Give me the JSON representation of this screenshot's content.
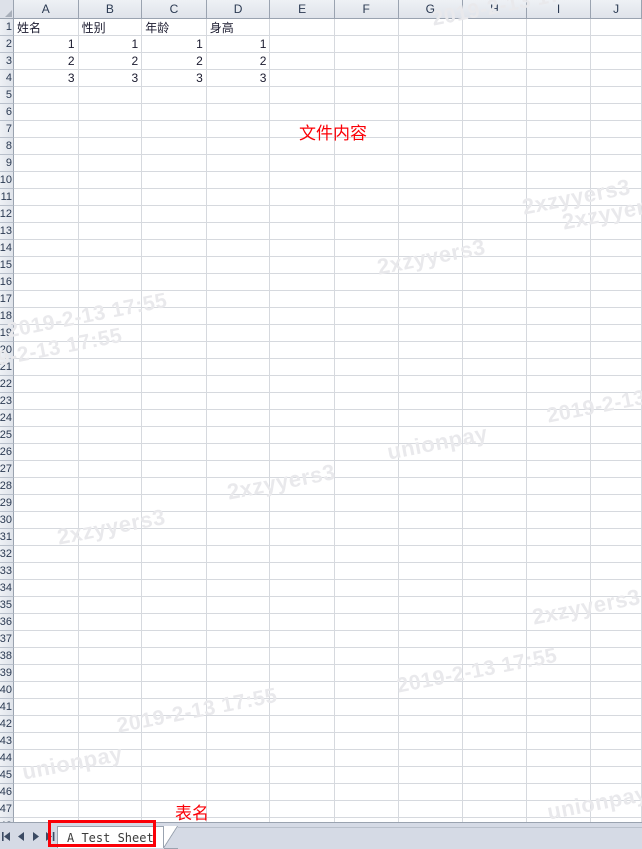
{
  "app": {
    "type": "spreadsheet",
    "sheet_tab_label": "A Test Sheet"
  },
  "grid": {
    "column_headers": [
      "A",
      "B",
      "C",
      "D",
      "E",
      "F",
      "G",
      "H",
      "I",
      "J"
    ],
    "row_count": 48,
    "first_row_number": 1,
    "cells": {
      "row1": [
        "姓名",
        "性别",
        "年龄",
        "身高"
      ],
      "row2": [
        "1",
        "1",
        "1",
        "1"
      ],
      "row3": [
        "2",
        "2",
        "2",
        "2"
      ],
      "row4": [
        "3",
        "3",
        "3",
        "3"
      ]
    }
  },
  "annotations": {
    "file_content_label": "文件内容",
    "sheet_name_label": "表名",
    "color": "#fb0007"
  },
  "tab_nav": {
    "first_label": "first-sheet",
    "prev_label": "previous-sheet",
    "next_label": "next-sheet",
    "last_label": "last-sheet"
  },
  "watermarks": {
    "date": "2019-2-13 17:55",
    "code": "2xzyyers3",
    "brand": "unionpay",
    "color": "#e9e9ec"
  }
}
